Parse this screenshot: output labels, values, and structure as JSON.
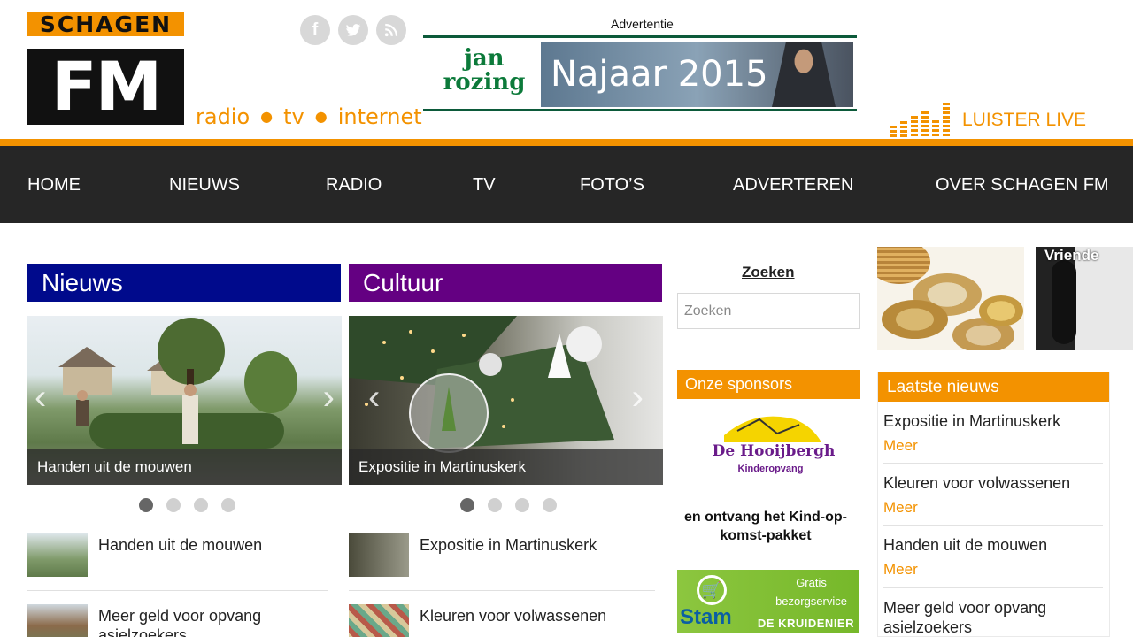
{
  "header": {
    "logo_top": "SCHAGEN",
    "logo_main": "FM",
    "tagline": [
      "radio",
      "tv",
      "internet"
    ],
    "social_icons": [
      "facebook-icon",
      "twitter-icon",
      "rss-icon"
    ],
    "ad_label": "Advertentie",
    "ad_brand": "jan rozing",
    "ad_text": "Najaar 2015",
    "listen_live": "LUISTER LIVE"
  },
  "nav": {
    "items": [
      "HOME",
      "NIEUWS",
      "RADIO",
      "TV",
      "FOTO’S",
      "ADVERTEREN",
      "OVER SCHAGEN FM"
    ]
  },
  "columns": {
    "news": {
      "title": "Nieuws",
      "slide_caption": "Handen uit de mouwen",
      "list": [
        "Handen uit de mouwen",
        "Meer geld voor opvang asielzoekers"
      ]
    },
    "culture": {
      "title": "Cultuur",
      "slide_caption": "Expositie in Martinuskerk",
      "list": [
        "Expositie in Martinuskerk",
        "Kleuren voor volwassenen"
      ]
    },
    "slider_dot_count": 4
  },
  "sidebar": {
    "search_label": "Zoeken",
    "search_placeholder": "Zoeken",
    "sponsors_title": "Onze sponsors",
    "sponsor_logo_text": "De Hooijbergh",
    "sponsor_logo_sub": "Kinderopvang",
    "sponsor_text": "en ontvang het Kind-op-komst-pakket",
    "stam_name": "Stam",
    "stam_tag_1": "Gratis",
    "stam_tag_2": "bezorgservice",
    "stam_sub": "DE KRUIDENIER"
  },
  "right": {
    "promo_label": "Vriende",
    "latest_title": "Laatste nieuws",
    "items": [
      {
        "title": "Expositie in Martinuskerk",
        "more": "Meer"
      },
      {
        "title": "Kleuren voor volwassenen",
        "more": "Meer"
      },
      {
        "title": "Handen uit de mouwen",
        "more": "Meer"
      },
      {
        "title": "Meer geld voor opvang asielzoekers",
        "more": ""
      }
    ]
  },
  "colors": {
    "accent": "#f39200",
    "nav_bg": "#262626",
    "news_blue": "#000a8c",
    "culture_purple": "#640082"
  }
}
